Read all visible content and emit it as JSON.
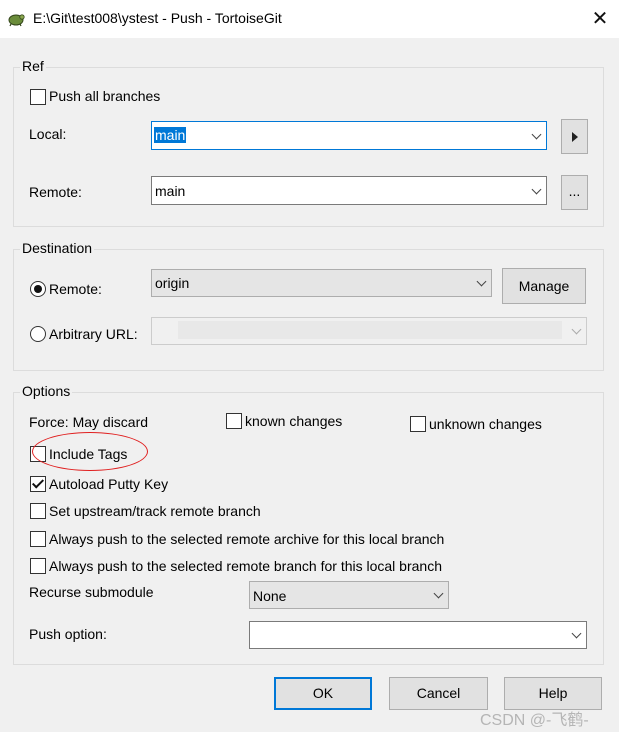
{
  "window": {
    "title": "E:\\Git\\test008\\ystest - Push - TortoiseGit",
    "close_glyph": "✕",
    "icon": "tortoisegit-icon"
  },
  "ref": {
    "group_label": "Ref",
    "push_all_branches": {
      "label": "Push all branches",
      "checked": false
    },
    "local": {
      "label": "Local:",
      "value": "main",
      "button_icon": "triangle-right-icon"
    },
    "remote": {
      "label": "Remote:",
      "value": "main",
      "button_label": "..."
    }
  },
  "destination": {
    "group_label": "Destination",
    "remote": {
      "label": "Remote:",
      "selected": true,
      "value": "origin"
    },
    "manage_button": "Manage",
    "arbitrary_url": {
      "label": "Arbitrary URL:",
      "selected": false,
      "value": ""
    }
  },
  "options": {
    "group_label": "Options",
    "force_label": "Force: May discard",
    "known_changes": {
      "label": "known changes",
      "checked": false
    },
    "unknown_changes": {
      "label": "unknown changes",
      "checked": false
    },
    "include_tags": {
      "label": "Include Tags",
      "checked": false
    },
    "autoload_putty": {
      "label": "Autoload Putty Key",
      "checked": true
    },
    "set_upstream": {
      "label": "Set upstream/track remote branch",
      "checked": false
    },
    "always_push_archive": {
      "label": "Always push to the selected remote archive for this local branch",
      "checked": false
    },
    "always_push_branch": {
      "label": "Always push to the selected remote branch for this local branch",
      "checked": false
    },
    "recurse_submodule": {
      "label": "Recurse submodule",
      "value": "None"
    },
    "push_option": {
      "label": "Push option:",
      "value": ""
    }
  },
  "buttons": {
    "ok": "OK",
    "cancel": "Cancel",
    "help": "Help"
  },
  "watermark": "CSDN @-飞鹤-",
  "colors": {
    "accent": "#0078d7",
    "annotation": "#e02020"
  }
}
